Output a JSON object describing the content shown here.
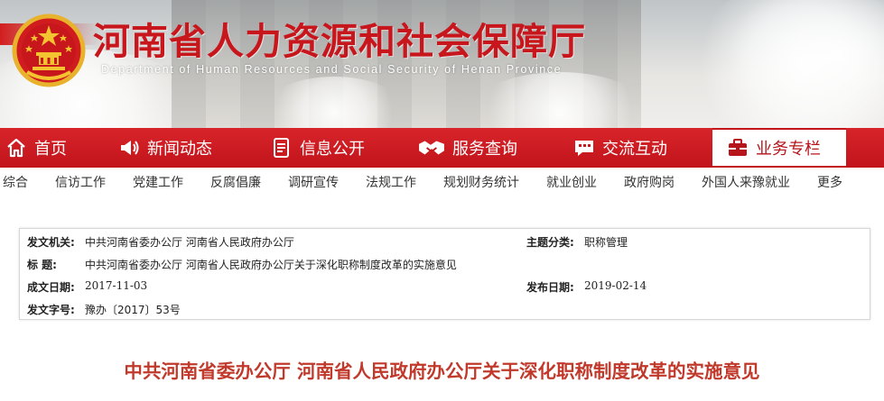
{
  "header": {
    "title": "河南省人力资源和社会保障厅",
    "subtitle": "Department of Human Resources and Social Security of Henan Province",
    "emblem_icon": "national-emblem-icon",
    "brand_color": "#c8161d"
  },
  "nav": {
    "items": [
      {
        "label": "首页",
        "icon": "home-icon"
      },
      {
        "label": "新闻动态",
        "icon": "megaphone-icon"
      },
      {
        "label": "信息公开",
        "icon": "document-icon"
      },
      {
        "label": "服务查询",
        "icon": "handshake-icon"
      },
      {
        "label": "交流互动",
        "icon": "chat-icon"
      },
      {
        "label": "业务专栏",
        "icon": "briefcase-icon",
        "active": true
      }
    ],
    "background_color": "#c8161d"
  },
  "subnav": {
    "items": [
      "综合",
      "信访工作",
      "党建工作",
      "反腐倡廉",
      "调研宣传",
      "法规工作",
      "规划财务统计",
      "就业创业",
      "政府购岗",
      "外国人来豫就业",
      "更多"
    ]
  },
  "document_info": {
    "issuer_label": "发文机关:",
    "issuer_value": "中共河南省委办公厅    河南省人民政府办公厅",
    "topic_label": "主题分类:",
    "topic_value": "职称管理",
    "title_label": "标      题:",
    "title_value": "中共河南省委办公厅    河南省人民政府办公厅关于深化职称制度改革的实施意见",
    "created_label": "成文日期:",
    "created_value": "2017-11-03",
    "published_label": "发布日期:",
    "published_value": "2019-02-14",
    "docno_label": "发文字号:",
    "docno_value": "豫办〔2017〕53号"
  },
  "article": {
    "headline": "中共河南省委办公厅    河南省人民政府办公厅关于深化职称制度改革的实施意见",
    "headline_color": "#c0392b"
  }
}
